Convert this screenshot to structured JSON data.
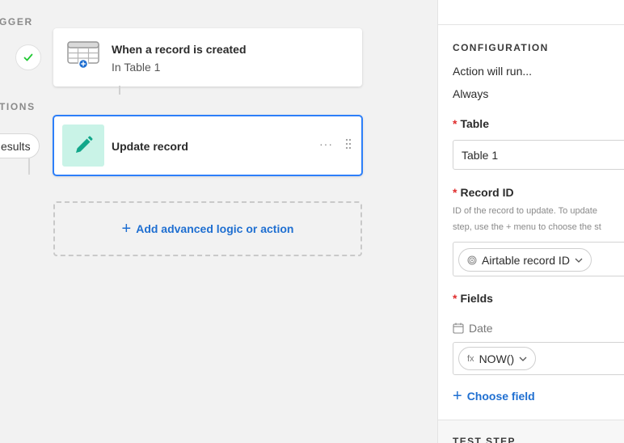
{
  "canvas": {
    "trigger_section_label": "GGER",
    "actions_section_label": "TIONS",
    "results_pill": "esults",
    "trigger_card": {
      "title": "When a record is created",
      "subtitle": "In Table 1",
      "icon": "table-icon"
    },
    "action_card": {
      "title": "Update record",
      "icon": "pencil-icon",
      "more": "···"
    },
    "add_action": {
      "plus": "+",
      "label": "Add advanced logic or action"
    }
  },
  "panel": {
    "configuration_heading": "CONFIGURATION",
    "action_runs_label": "Action will run...",
    "action_runs_value": "Always",
    "table": {
      "required_mark": "*",
      "label": "Table",
      "value": "Table 1"
    },
    "record_id": {
      "required_mark": "*",
      "label": "Record ID",
      "help_line_1": "ID of the record to update. To update",
      "help_line_2": "step, use the + menu to choose the st",
      "chip_label": "Airtable record ID"
    },
    "fields": {
      "required_mark": "*",
      "label": "Fields",
      "date_label": "Date",
      "formula_chip": "NOW()",
      "formula_icon": "fx"
    },
    "choose_field": {
      "plus": "+",
      "label": "Choose field"
    },
    "test_step_heading": "TEST STEP"
  },
  "colors": {
    "accent_blue": "#2d7ff9",
    "link_blue": "#1f6fd1",
    "action_icon_bg": "#c9f3e7",
    "action_icon_fg": "#11a78a",
    "required_red": "#e02e2e",
    "check_green": "#20c933"
  }
}
